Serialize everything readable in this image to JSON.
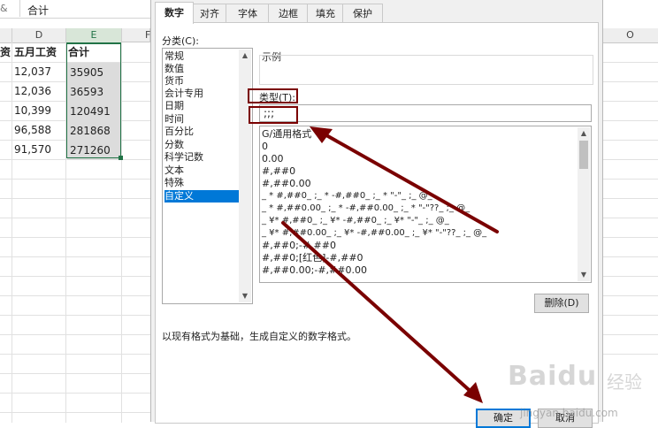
{
  "formula_bar": {
    "fx_glyph": "&",
    "value": "合计"
  },
  "sheet": {
    "columns": {
      "d": "D",
      "e": "E",
      "f": "F",
      "o": "O"
    },
    "header_row": {
      "c_partial": "资",
      "d": "五月工资",
      "e": "合计"
    },
    "rows": [
      {
        "d": "12,037",
        "e": "35905"
      },
      {
        "d": "12,036",
        "e": "36593"
      },
      {
        "d": "10,399",
        "e": "120491"
      },
      {
        "d": "96,588",
        "e": "281868"
      },
      {
        "d": "91,570",
        "e": "271260"
      }
    ]
  },
  "dialog": {
    "tabs": [
      "数字",
      "对齐",
      "字体",
      "边框",
      "填充",
      "保护"
    ],
    "category_label": "分类(C):",
    "categories": [
      "常规",
      "数值",
      "货币",
      "会计专用",
      "日期",
      "时间",
      "百分比",
      "分数",
      "科学记数",
      "文本",
      "特殊",
      "自定义"
    ],
    "selected_category": "自定义",
    "sample_label": "示例",
    "type_label": "类型(T):",
    "type_value": ";;;",
    "formats": [
      "G/通用格式",
      "0",
      "0.00",
      "#,##0",
      "#,##0.00",
      "_ * #,##0_ ;_ * -#,##0_ ;_ * \"-\"_ ;_ @_",
      "_ * #,##0.00_ ;_ * -#,##0.00_ ;_ * \"-\"??_ ;_ @_",
      "_ ¥* #,##0_ ;_ ¥* -#,##0_ ;_ ¥* \"-\"_ ;_ @_",
      "_ ¥* #,##0.00_ ;_ ¥* -#,##0.00_ ;_ ¥* \"-\"??_ ;_ @_",
      "#,##0;-#,##0",
      "#,##0;[红色]-#,##0",
      "#,##0.00;-#,##0.00"
    ],
    "delete_button": "删除(D)",
    "hint": "以现有格式为基础，生成自定义的数字格式。",
    "ok_button": "确定",
    "cancel_button": "取消"
  },
  "annotation_color": "#7a0000",
  "watermark": {
    "logo": "Baidu",
    "cn": "经验",
    "url": "jingyan.baidu.com"
  }
}
